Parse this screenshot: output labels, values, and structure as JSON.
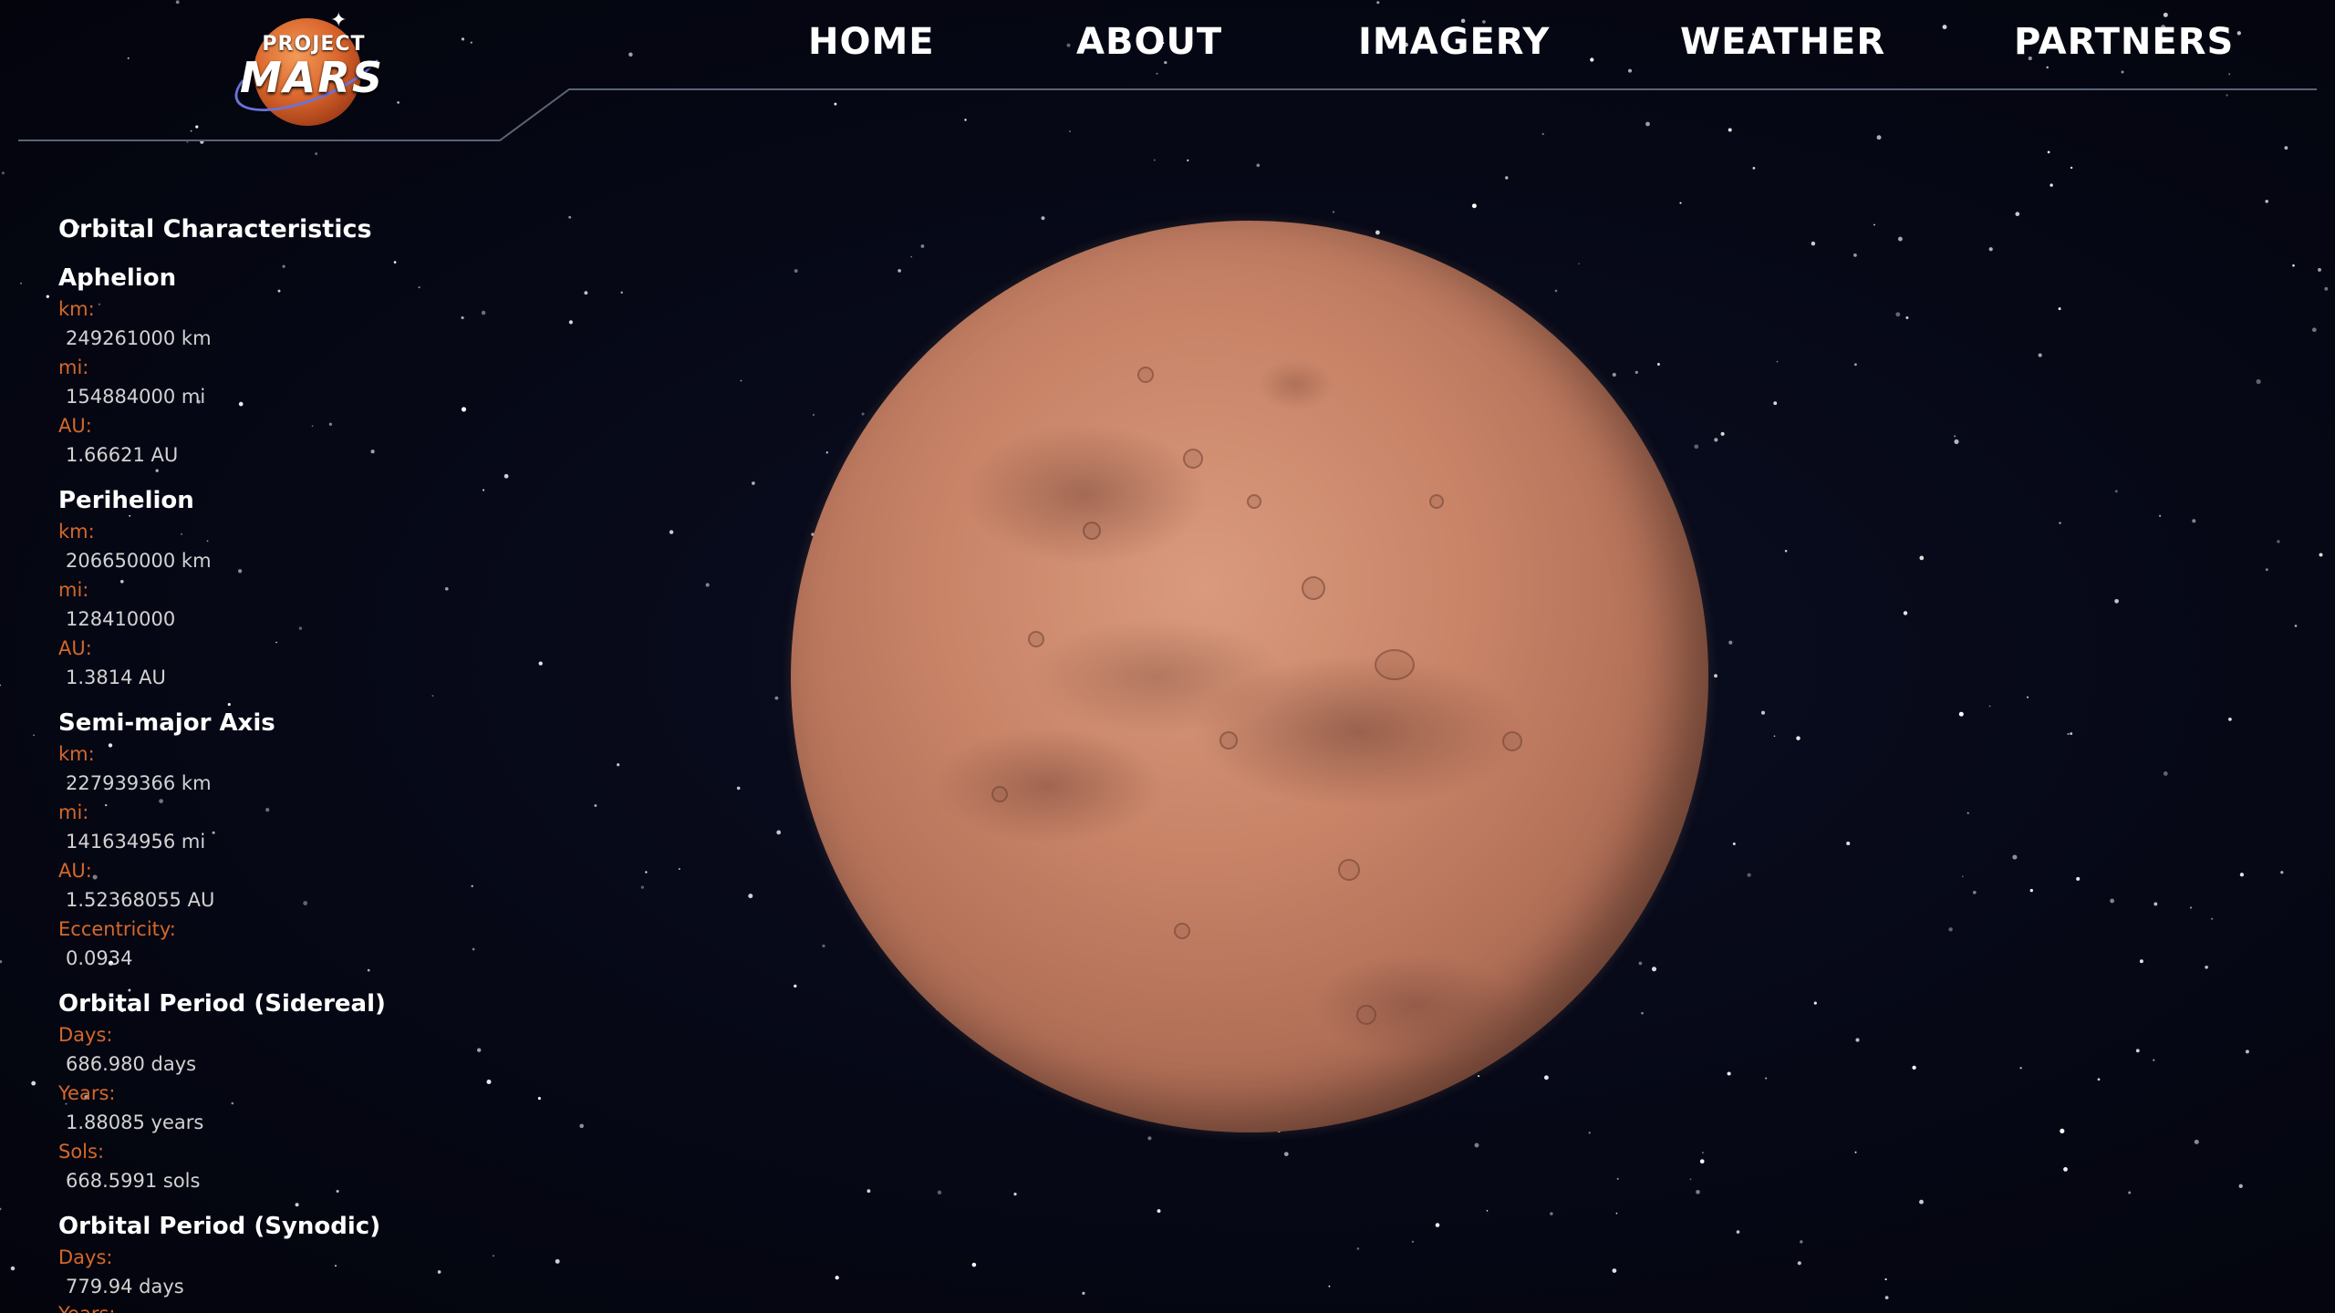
{
  "logo": {
    "top_text": "PROJECT",
    "main_text": "MARS",
    "icon": "mars-logo-icon"
  },
  "nav": {
    "items": [
      {
        "label": "HOME"
      },
      {
        "label": "ABOUT"
      },
      {
        "label": "IMAGERY"
      },
      {
        "label": "WEATHER"
      },
      {
        "label": "PARTNERS"
      }
    ]
  },
  "sidebar": {
    "title": "Orbital Characteristics",
    "aphelion": {
      "heading": "Aphelion",
      "km_label": "km:",
      "km_value": "249261000 km",
      "mi_label": "mi:",
      "mi_value": "154884000 mi",
      "au_label": "AU:",
      "au_value": "1.66621 AU"
    },
    "perihelion": {
      "heading": "Perihelion",
      "km_label": "km:",
      "km_value": "206650000 km",
      "mi_label": "mi:",
      "mi_value": "128410000",
      "au_label": "AU:",
      "au_value": "1.3814 AU"
    },
    "semi_major": {
      "heading": "Semi-major Axis",
      "km_label": "km:",
      "km_value": "227939366 km",
      "mi_label": "mi:",
      "mi_value": "141634956 mi",
      "au_label": "AU:",
      "au_value": "1.52368055 AU",
      "ecc_label": "Eccentricity:",
      "ecc_value": "0.0934"
    },
    "sidereal": {
      "heading": "Orbital Period (Sidereal)",
      "days_label": "Days:",
      "days_value": "686.980 days",
      "years_label": "Years:",
      "years_value": "1.88085 years",
      "sols_label": "Sols:",
      "sols_value": "668.5991 sols"
    },
    "synodic": {
      "heading": "Orbital Period (Synodic)",
      "days_label": "Days:",
      "days_value": "779.94 days",
      "years_label": "Years:"
    }
  },
  "colors": {
    "background": "#060816",
    "label_accent": "#d4682a",
    "value_text": "#d2d2d2",
    "heading_text": "#ffffff",
    "nav_text": "#ffffff",
    "planet": "#c98468"
  }
}
